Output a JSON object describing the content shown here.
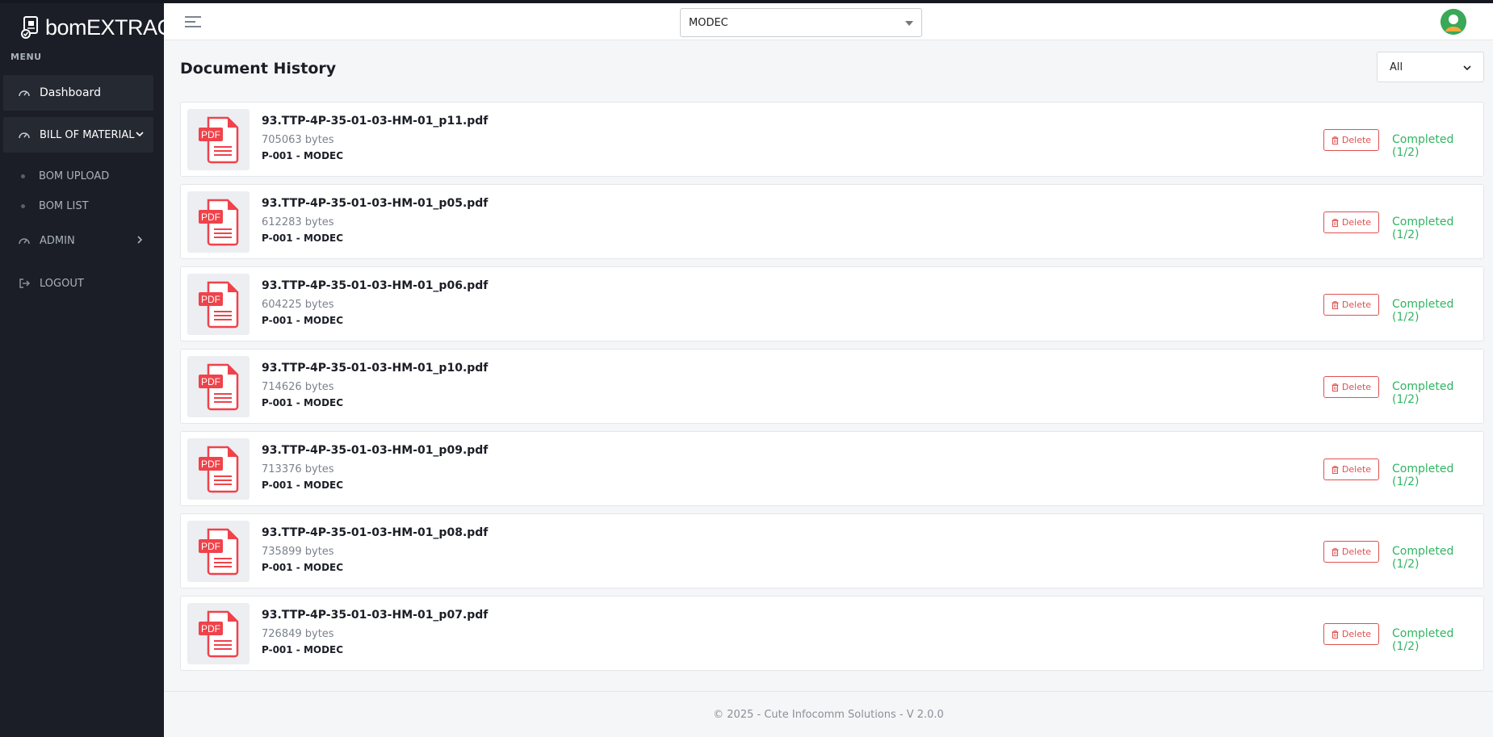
{
  "app": {
    "brand": "bomEXTRACT",
    "menu_title": "MENU"
  },
  "sidebar": {
    "dashboard": "Dashboard",
    "bom": "BILL OF MATERIAL",
    "bom_upload": "BOM UPLOAD",
    "bom_list": "BOM LIST",
    "admin": "ADMIN",
    "logout": "LOGOUT"
  },
  "header": {
    "selected_company": "MODEC"
  },
  "main": {
    "title": "Document History",
    "filter_value": "All",
    "delete_label": "Delete",
    "documents": [
      {
        "name": "93.TTP-4P-35-01-03-HM-01_p11.pdf",
        "size": "705063 bytes",
        "project": "P-001 - MODEC",
        "status": "Completed (1/2)"
      },
      {
        "name": "93.TTP-4P-35-01-03-HM-01_p05.pdf",
        "size": "612283 bytes",
        "project": "P-001 - MODEC",
        "status": "Completed (1/2)"
      },
      {
        "name": "93.TTP-4P-35-01-03-HM-01_p06.pdf",
        "size": "604225 bytes",
        "project": "P-001 - MODEC",
        "status": "Completed (1/2)"
      },
      {
        "name": "93.TTP-4P-35-01-03-HM-01_p10.pdf",
        "size": "714626 bytes",
        "project": "P-001 - MODEC",
        "status": "Completed (1/2)"
      },
      {
        "name": "93.TTP-4P-35-01-03-HM-01_p09.pdf",
        "size": "713376 bytes",
        "project": "P-001 - MODEC",
        "status": "Completed (1/2)"
      },
      {
        "name": "93.TTP-4P-35-01-03-HM-01_p08.pdf",
        "size": "735899 bytes",
        "project": "P-001 - MODEC",
        "status": "Completed (1/2)"
      },
      {
        "name": "93.TTP-4P-35-01-03-HM-01_p07.pdf",
        "size": "726849 bytes",
        "project": "P-001 - MODEC",
        "status": "Completed (1/2)"
      }
    ]
  },
  "footer": {
    "text": "© 2025 - Cute Infocomm Solutions - V 2.0.0"
  },
  "colors": {
    "sidebar_bg": "#1b1e26",
    "accent_red": "#e0504f",
    "status_green": "#2fb562",
    "pdf_red": "#f0424a"
  }
}
